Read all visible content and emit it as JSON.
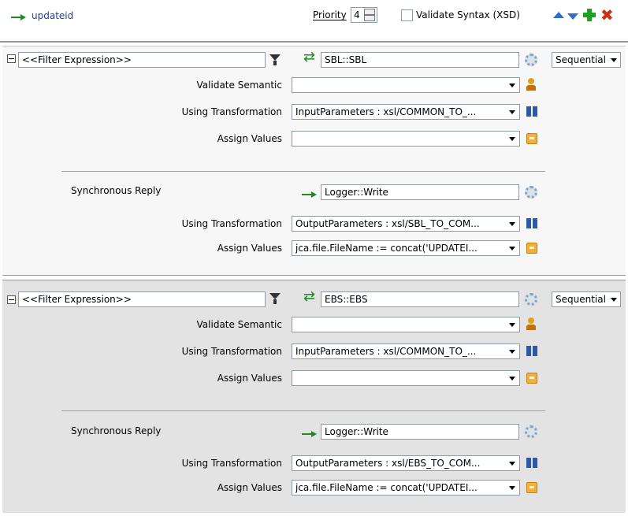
{
  "header": {
    "route_name": "updateid",
    "priority_label": "Priority",
    "priority_value": "4",
    "validate_syntax_label": "Validate Syntax (XSD)"
  },
  "rules": [
    {
      "filter_expression": "<<Filter Expression>>",
      "target": "SBL::SBL",
      "execution": "Sequential",
      "validate_semantic_label": "Validate Semantic",
      "validate_semantic_value": "",
      "using_transformation_label": "Using Transformation",
      "using_transformation_value": "InputParameters : xsl/COMMON_TO_...",
      "assign_values_label": "Assign Values",
      "assign_values_value": "",
      "reply_label": "Synchronous Reply",
      "reply_target": "Logger::Write",
      "reply_transformation_label": "Using Transformation",
      "reply_transformation_value": "OutputParameters : xsl/SBL_TO_COM...",
      "reply_assign_label": "Assign Values",
      "reply_assign_value": "jca.file.FileName := concat('UPDATEI..."
    },
    {
      "filter_expression": "<<Filter Expression>>",
      "target": "EBS::EBS",
      "execution": "Sequential",
      "validate_semantic_label": "Validate Semantic",
      "validate_semantic_value": "",
      "using_transformation_label": "Using Transformation",
      "using_transformation_value": "InputParameters : xsl/COMMON_TO_...",
      "assign_values_label": "Assign Values",
      "assign_values_value": "",
      "reply_label": "Synchronous Reply",
      "reply_target": "Logger::Write",
      "reply_transformation_label": "Using Transformation",
      "reply_transformation_value": "OutputParameters : xsl/EBS_TO_COM...",
      "reply_assign_label": "Assign Values",
      "reply_assign_value": "jca.file.FileName := concat('UPDATEI..."
    }
  ],
  "colors": {
    "panel_1_bg": "#f7f7f7",
    "panel_2_bg": "#e3e3e3",
    "link": "#1a3fa6",
    "arrow_green": "#1f8a1f"
  }
}
